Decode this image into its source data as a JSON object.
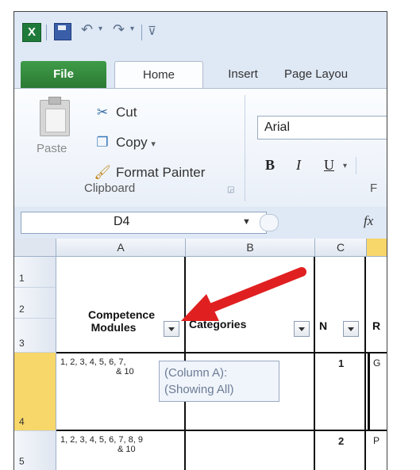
{
  "app": {
    "logo": "excel-icon"
  },
  "tabs": [
    "File",
    "Home",
    "Insert",
    "Page Layou"
  ],
  "clipboard": {
    "paste_label": "Paste",
    "cut_label": "Cut",
    "copy_label": "Copy",
    "format_painter_label": "Format Painter",
    "group_label": "Clipboard"
  },
  "font": {
    "name": "Arial",
    "bold": "B",
    "italic": "I",
    "underline": "U",
    "group_label_partial": "F"
  },
  "formula_bar": {
    "name_box": "D4",
    "fx": "fx"
  },
  "columns": [
    "A",
    "B",
    "C"
  ],
  "rows": [
    "1",
    "2",
    "3",
    "4",
    "5"
  ],
  "headers": {
    "col_a_line1": "Competence",
    "col_a_line2": "Modules",
    "col_b": "Categories",
    "col_c": "N",
    "col_d": "R"
  },
  "data_rows": [
    {
      "modules_l1": "1, 2, 3, 4, 5, 6, 7,",
      "modules_l2": "& 10",
      "num": "1",
      "next": "G"
    },
    {
      "modules_l1": "1, 2, 3, 4, 5, 6, 7, 8, 9",
      "modules_l2": "& 10",
      "num": "2",
      "next": "P"
    }
  ],
  "tooltip": {
    "line1": "(Column A):",
    "line2": "(Showing All)"
  },
  "colors": {
    "file_tab": "#2b7a33",
    "ribbon_bg": "#dfe8f5",
    "annotation_arrow": "#e02020",
    "selected_row": "#f7d66a"
  }
}
